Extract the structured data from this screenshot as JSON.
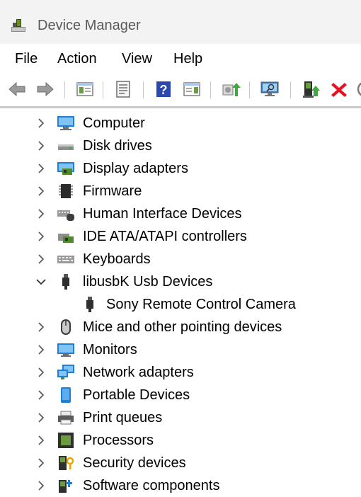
{
  "window": {
    "title": "Device Manager"
  },
  "menu": {
    "file": "File",
    "action": "Action",
    "view": "View",
    "help": "Help"
  },
  "toolbar": {
    "icons": [
      "back-arrow-icon",
      "forward-arrow-icon",
      "show-hide-console-tree-icon",
      "properties-icon",
      "help-icon",
      "action-pane-icon",
      "update-driver-icon",
      "scan-hardware-icon",
      "enable-device-icon",
      "uninstall-device-icon"
    ]
  },
  "tree": {
    "items": [
      {
        "label": "Computer",
        "state": "collapsed"
      },
      {
        "label": "Disk drives",
        "state": "collapsed"
      },
      {
        "label": "Display adapters",
        "state": "collapsed"
      },
      {
        "label": "Firmware",
        "state": "collapsed"
      },
      {
        "label": "Human Interface Devices",
        "state": "collapsed"
      },
      {
        "label": "IDE ATA/ATAPI controllers",
        "state": "collapsed"
      },
      {
        "label": "Keyboards",
        "state": "collapsed"
      },
      {
        "label": "libusbK Usb Devices",
        "state": "expanded"
      },
      {
        "label": "Sony Remote Control Camera",
        "state": "child"
      },
      {
        "label": "Mice and other pointing devices",
        "state": "collapsed"
      },
      {
        "label": "Monitors",
        "state": "collapsed"
      },
      {
        "label": "Network adapters",
        "state": "collapsed"
      },
      {
        "label": "Portable Devices",
        "state": "collapsed"
      },
      {
        "label": "Print queues",
        "state": "collapsed"
      },
      {
        "label": "Processors",
        "state": "collapsed"
      },
      {
        "label": "Security devices",
        "state": "collapsed"
      },
      {
        "label": "Software components",
        "state": "collapsed"
      }
    ]
  },
  "colors": {
    "accent": "#0078d4",
    "delete": "#e81123",
    "titlebar": "#f3f3f3"
  }
}
